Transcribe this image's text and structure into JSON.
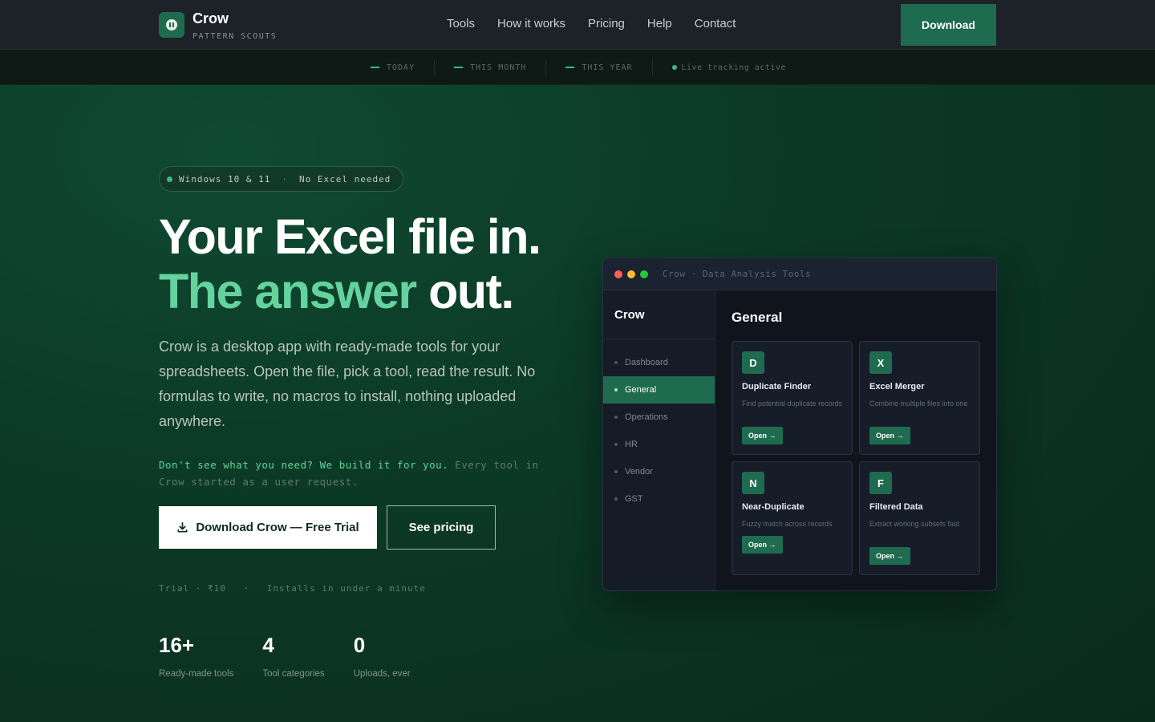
{
  "nav": {
    "brand_name": "Crow",
    "brand_sub": "PATTERN SCOUTS",
    "links": [
      "Tools",
      "How it works",
      "Pricing",
      "Help",
      "Contact"
    ],
    "download_label": "Download"
  },
  "strip": {
    "today": "TODAY",
    "month": "THIS MONTH",
    "year": "THIS YEAR",
    "live": "Live tracking active"
  },
  "hero": {
    "pill_left": "Windows 10 & 11",
    "pill_sep": "·",
    "pill_right": "No Excel needed",
    "headline_line1": "Your Excel file in.",
    "headline_accent": "The answer",
    "headline_rest": " out.",
    "lead": "Crow is a desktop app with ready-made tools for your spreadsheets. Open the file, pick a tool, read the result. No formulas to write, no macros to install, nothing uploaded anywhere.",
    "promo_highlight": "Don't see what you need? We build it for you.",
    "promo_rest": " Every tool in Crow started as a user request.",
    "primary_button": "Download Crow — Free Trial",
    "secondary_button": "See pricing",
    "meta": [
      "Trial · ₹10",
      "·",
      "Installs in under a minute"
    ],
    "stats": [
      {
        "num": "16+",
        "label": "Ready-made tools"
      },
      {
        "num": "4",
        "label": "Tool categories"
      },
      {
        "num": "0",
        "label": "Uploads, ever"
      }
    ]
  },
  "app": {
    "title": "Crow · Data Analysis Tools",
    "traffic_colors": [
      "#ff5f57",
      "#febc2e",
      "#28c840"
    ],
    "sidebar_brand": "Crow",
    "sidebar_items": [
      "Dashboard",
      "General",
      "Operations",
      "HR",
      "Vendor",
      "GST"
    ],
    "active_item": "General",
    "main_title": "General",
    "cards": [
      {
        "badge": "D",
        "name": "Duplicate Finder",
        "desc": "Find potential duplicate records",
        "open": "Open →"
      },
      {
        "badge": "X",
        "name": "Excel Merger",
        "desc": "Combine multiple files into one",
        "open": "Open →"
      },
      {
        "badge": "N",
        "name": "Near-Duplicate",
        "desc": "Fuzzy match across records",
        "open": "Open →"
      },
      {
        "badge": "F",
        "name": "Filtered Data",
        "desc": "Extract working subsets fast",
        "open": "Open →"
      }
    ]
  },
  "colors": {
    "accent": "#64d39e",
    "brand_green": "#1f6b4f",
    "status_green": "#3dbb7c"
  },
  "icons": {
    "logo": "pause-icon",
    "download": "download-icon"
  }
}
